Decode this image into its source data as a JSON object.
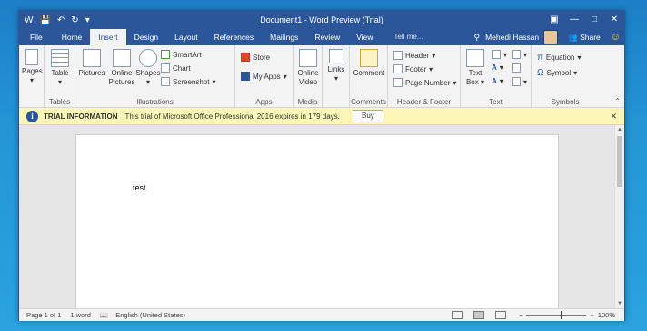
{
  "titlebar": {
    "title": "Document1 - Word Preview (Trial)",
    "qat_save_icon": "save-icon",
    "qat_undo_icon": "undo-icon",
    "qat_redo_icon": "redo-icon"
  },
  "tabs": [
    {
      "label": "File"
    },
    {
      "label": "Home"
    },
    {
      "label": "Insert"
    },
    {
      "label": "Design"
    },
    {
      "label": "Layout"
    },
    {
      "label": "References"
    },
    {
      "label": "Mailings"
    },
    {
      "label": "Review"
    },
    {
      "label": "View"
    }
  ],
  "tellme": {
    "placeholder": "Tell me..."
  },
  "user": {
    "name": "Mehedi Hassan",
    "share_label": "Share"
  },
  "ribbon": {
    "pages": {
      "label": "Pages",
      "group": ""
    },
    "tables": {
      "table_label": "Table",
      "group": "Tables"
    },
    "illustrations": {
      "pictures": "Pictures",
      "online_pictures": "Online Pictures",
      "shapes": "Shapes",
      "smartart": "SmartArt",
      "chart": "Chart",
      "screenshot": "Screenshot",
      "group": "Illustrations"
    },
    "apps": {
      "store": "Store",
      "myapps": "My Apps",
      "group": "Apps"
    },
    "media": {
      "online_video": "Online Video",
      "group": "Media"
    },
    "links": {
      "label": "Links",
      "group": ""
    },
    "comments": {
      "comment": "Comment",
      "group": "Comments"
    },
    "header_footer": {
      "header": "Header",
      "footer": "Footer",
      "page_number": "Page Number",
      "group": "Header & Footer"
    },
    "text": {
      "textbox": "Text Box",
      "group": "Text"
    },
    "symbols": {
      "equation": "Equation",
      "symbol": "Symbol",
      "group": "Symbols"
    }
  },
  "trial": {
    "title": "TRIAL INFORMATION",
    "message": "This trial of Microsoft Office Professional 2016 expires in 179 days.",
    "buy": "Buy"
  },
  "document": {
    "text": "test"
  },
  "status": {
    "page": "Page 1 of 1",
    "words": "1 word",
    "language": "English (United States)",
    "zoom": "100%"
  }
}
